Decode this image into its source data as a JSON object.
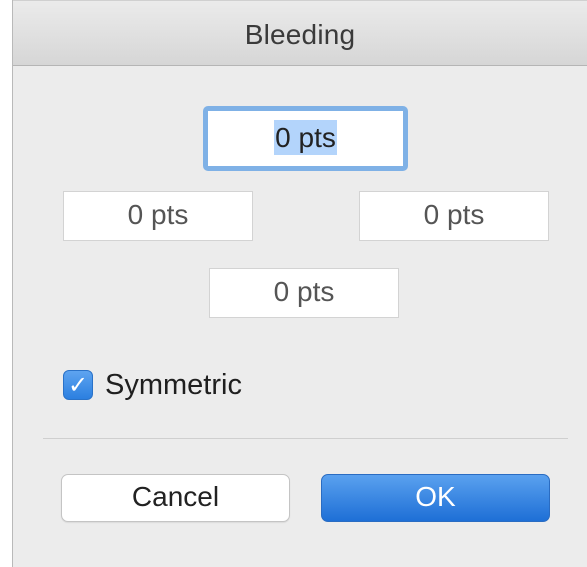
{
  "dialog": {
    "title": "Bleeding"
  },
  "fields": {
    "top": {
      "value": "0 pts"
    },
    "left": {
      "value": "0 pts"
    },
    "right": {
      "value": "0 pts"
    },
    "bottom": {
      "value": "0 pts"
    }
  },
  "symmetric": {
    "label": "Symmetric",
    "checked": true,
    "check_glyph": "✓"
  },
  "buttons": {
    "cancel_label": "Cancel",
    "ok_label": "OK"
  },
  "colors": {
    "accent": "#2b7fe0",
    "focus_ring": "#7fb1e6",
    "selection": "#b3d4fb"
  }
}
